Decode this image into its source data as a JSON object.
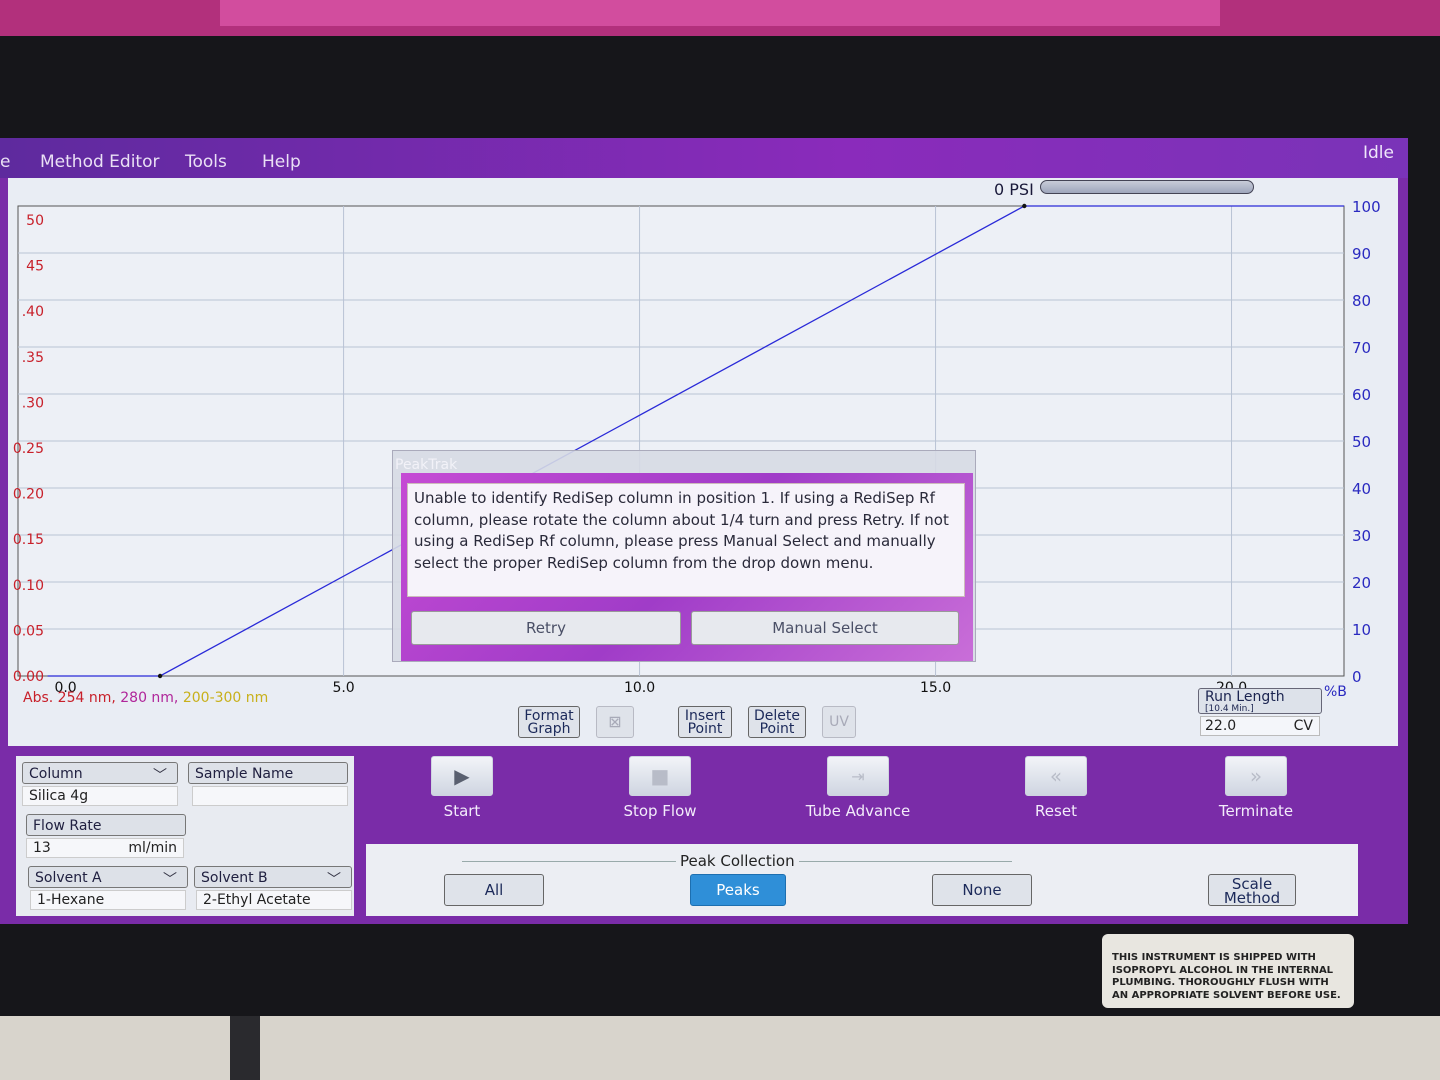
{
  "menu": {
    "items": [
      "e",
      "Method Editor",
      "Tools",
      "Help"
    ],
    "status": "Idle"
  },
  "pressure": {
    "label": "0 PSI"
  },
  "graph": {
    "left_axis_ticks": [
      "50",
      "45",
      ".40",
      ".35",
      ".30",
      "0.25",
      "0.20",
      "0.15",
      "0.10",
      "0.05",
      "0.00"
    ],
    "right_axis_ticks": [
      "100",
      "90",
      "80",
      "70",
      "60",
      "50",
      "40",
      "30",
      "20",
      "10",
      "0"
    ],
    "x_axis_ticks": [
      "0.0",
      "5.0",
      "10.0",
      "15.0",
      "20.0"
    ],
    "right_axis_unit": "%B",
    "legend": {
      "abs_prefix": "Abs. 254 nm,",
      "wl2": "280 nm,",
      "wl3": "200-300 nm"
    }
  },
  "chart_data": {
    "type": "line",
    "series": [
      {
        "x": [
          0.0,
          1.9,
          16.5,
          21.9
        ],
        "y": [
          0,
          0,
          100,
          100
        ]
      }
    ],
    "xlim": [
      -0.5,
      21.9
    ],
    "ylim": [
      0,
      100
    ],
    "ylim_left": [
      0,
      0.5
    ],
    "x_ticks": [
      0,
      5,
      10,
      15,
      20
    ],
    "y_ticks": [
      0,
      10,
      20,
      30,
      40,
      50,
      60,
      70,
      80,
      90,
      100
    ],
    "grid": true,
    "colors": {
      "line": "#2a2ad8",
      "left_axis": "#c8202a",
      "right_axis": "#2a2ac0",
      "grid": "#b9c3d4"
    }
  },
  "graph_tools": {
    "format_graph": [
      "Format",
      "Graph"
    ],
    "insert_point": [
      "Insert",
      "Point"
    ],
    "delete_point": [
      "Delete",
      "Point"
    ],
    "uv": "UV"
  },
  "run_length": {
    "label": "Run Length",
    "sub": "[10.4 Min.]",
    "value": "22.0",
    "unit": "CV"
  },
  "fields": {
    "column": {
      "label": "Column",
      "value": "Silica 4g"
    },
    "sample_name": {
      "label": "Sample Name",
      "value": ""
    },
    "flow_rate": {
      "label": "Flow Rate",
      "value": "13",
      "unit": "ml/min"
    },
    "solvent_a": {
      "label": "Solvent A",
      "value": "1-Hexane"
    },
    "solvent_b": {
      "label": "Solvent B",
      "value": "2-Ethyl Acetate"
    }
  },
  "actions": {
    "start": "Start",
    "stop_flow": "Stop Flow",
    "tube_advance": "Tube Advance",
    "reset": "Reset",
    "terminate": "Terminate"
  },
  "peak_collection": {
    "title": "Peak Collection",
    "all": "All",
    "peaks": "Peaks",
    "none": "None",
    "scale_method": [
      "Scale",
      "Method"
    ]
  },
  "dialog": {
    "title": "PeakTrak",
    "message": "Unable to identify RediSep column in position 1. If using a RediSep Rf column, please rotate the column about 1/4 turn and press Retry. If not using a RediSep Rf column, please press Manual Select and manually select the proper RediSep column from the drop down menu.",
    "retry": "Retry",
    "manual_select": "Manual Select"
  },
  "sticker": {
    "text": [
      "THIS INSTRUMENT IS SHIPPED WITH",
      "ISOPROPYL ALCOHOL IN THE INTERNAL",
      "PLUMBING. THOROUGHLY FLUSH WITH",
      "AN APPROPRIATE SOLVENT BEFORE USE."
    ]
  }
}
